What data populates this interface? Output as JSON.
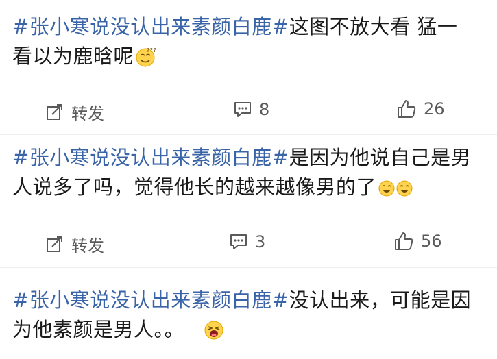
{
  "posts": [
    {
      "topic": "#张小寒说没认出来素颜白鹿#",
      "line1_rest": "这图不放大看 猛一",
      "line2": "看以为鹿晗呢",
      "emoji": "dizzy-face-emoji",
      "repost_label": "转发",
      "comment_count": "8",
      "like_count": "26"
    },
    {
      "topic": "#张小寒说没认出来素颜白鹿#",
      "line1_rest": "是因为他说自己是男",
      "line2": "人说多了吗，觉得他长的越来越像男的了",
      "emoji": "crying-laughing-emoji",
      "repost_label": "转发",
      "comment_count": "3",
      "like_count": "56"
    },
    {
      "topic": "#张小寒说没认出来素颜白鹿#",
      "line1_rest": "没认出来，可能是因",
      "line2": "为他素颜是男人。。",
      "emoji": "laughing-face-emoji"
    }
  ],
  "colors": {
    "topic": "#3a64a8",
    "text": "#1a1a1a",
    "action": "#5a5a5a",
    "emoji_yellow": "#ffd34d"
  },
  "icons": {
    "repost": "repost-icon",
    "comment": "comment-icon",
    "like": "thumbs-up-icon"
  }
}
